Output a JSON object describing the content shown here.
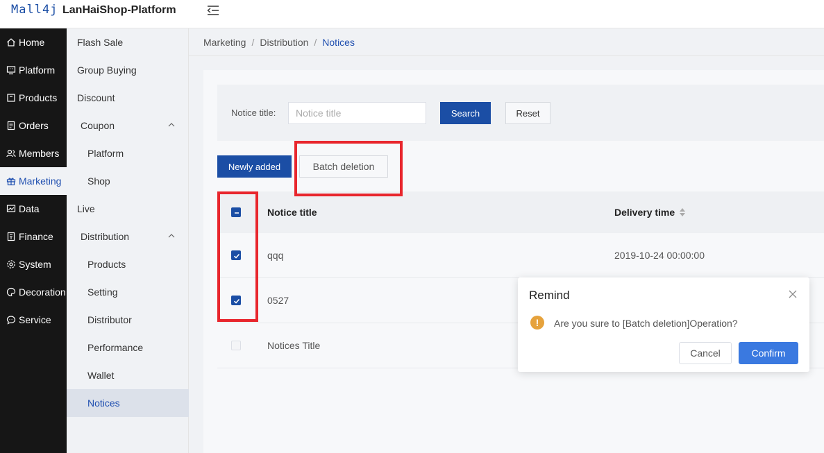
{
  "header": {
    "logo": "Mall4j",
    "title": "LanHaiShop-Platform"
  },
  "nav": [
    {
      "label": "Home",
      "icon": "home-icon"
    },
    {
      "label": "Platform",
      "icon": "monitor-icon"
    },
    {
      "label": "Products",
      "icon": "box-icon"
    },
    {
      "label": "Orders",
      "icon": "document-icon"
    },
    {
      "label": "Members",
      "icon": "users-icon"
    },
    {
      "label": "Marketing",
      "icon": "gift-icon",
      "active": true
    },
    {
      "label": "Data",
      "icon": "chart-icon"
    },
    {
      "label": "Finance",
      "icon": "ledger-icon"
    },
    {
      "label": "System",
      "icon": "gear-icon"
    },
    {
      "label": "Decoration",
      "icon": "palette-icon"
    },
    {
      "label": "Service",
      "icon": "chat-icon"
    }
  ],
  "subnav": [
    {
      "label": "Flash Sale",
      "level": 0
    },
    {
      "label": "Group Buying",
      "level": 0
    },
    {
      "label": "Discount",
      "level": 0
    },
    {
      "label": "Coupon",
      "level": 1,
      "group": true
    },
    {
      "label": "Platform",
      "level": 2
    },
    {
      "label": "Shop",
      "level": 2
    },
    {
      "label": "Live",
      "level": 0
    },
    {
      "label": "Distribution",
      "level": 1,
      "group": true
    },
    {
      "label": "Products",
      "level": 2
    },
    {
      "label": "Setting",
      "level": 2
    },
    {
      "label": "Distributor",
      "level": 2
    },
    {
      "label": "Performance",
      "level": 2
    },
    {
      "label": "Wallet",
      "level": 2
    },
    {
      "label": "Notices",
      "level": 2,
      "active": true
    }
  ],
  "breadcrumb": {
    "items": [
      "Marketing",
      "Distribution"
    ],
    "current": "Notices",
    "separator": "/"
  },
  "search": {
    "label": "Notice title:",
    "placeholder": "Notice title",
    "search_button": "Search",
    "reset_button": "Reset"
  },
  "actions": {
    "add_button": "Newly added",
    "batch_delete_button": "Batch deletion"
  },
  "table": {
    "columns": [
      "Notice title",
      "Delivery time"
    ],
    "rows": [
      {
        "title": "qqq",
        "time": "2019-10-24 00:00:00",
        "checked": true
      },
      {
        "title": "0527",
        "time": "",
        "checked": true
      },
      {
        "title": "Notices Title",
        "time": "",
        "checked": false
      }
    ]
  },
  "dialog": {
    "title": "Remind",
    "message": "Are you sure to [Batch deletion]Operation?",
    "cancel_button": "Cancel",
    "confirm_button": "Confirm"
  },
  "colors": {
    "primary": "#1b4ea5",
    "sidebar_dark": "#161616",
    "highlight": "#e8262d",
    "warning": "#e6a23c",
    "confirm": "#3a79e0"
  }
}
